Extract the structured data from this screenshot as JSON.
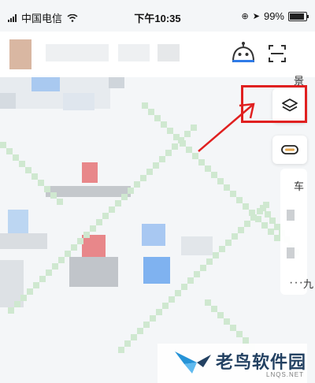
{
  "status_bar": {
    "carrier": "中国电信",
    "time": "下午10:35",
    "battery": "99%",
    "battery_level": 0.99
  },
  "colors": {
    "highlight": "#e02020",
    "route_green": "#cfe8d0",
    "poi_blue": "#7fb2f0",
    "poi_red": "#e8878a"
  },
  "toolbar": {
    "robot_icon": "robot-assistant-icon",
    "scan_icon": "scan-icon",
    "layers_icon": "layers-icon",
    "cloud_icon": "cloud-icon"
  },
  "side": {
    "label_top": "景",
    "label_mid": "车",
    "label_bottom": "九",
    "more": "···"
  },
  "watermark": {
    "brand": "老鸟软件园",
    "sub": "LNQS.NET"
  }
}
